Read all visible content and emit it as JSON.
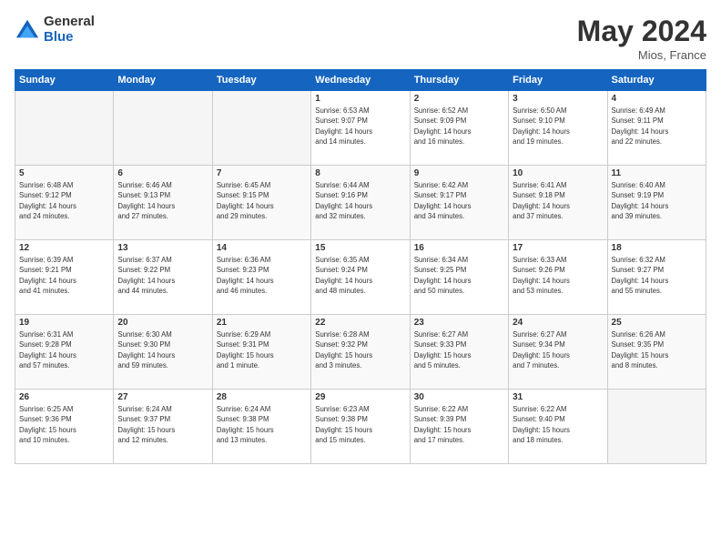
{
  "logo": {
    "general": "General",
    "blue": "Blue"
  },
  "title": {
    "month_year": "May 2024",
    "location": "Mios, France"
  },
  "days_of_week": [
    "Sunday",
    "Monday",
    "Tuesday",
    "Wednesday",
    "Thursday",
    "Friday",
    "Saturday"
  ],
  "weeks": [
    [
      {
        "day": "",
        "info": ""
      },
      {
        "day": "",
        "info": ""
      },
      {
        "day": "",
        "info": ""
      },
      {
        "day": "1",
        "info": "Sunrise: 6:53 AM\nSunset: 9:07 PM\nDaylight: 14 hours\nand 14 minutes."
      },
      {
        "day": "2",
        "info": "Sunrise: 6:52 AM\nSunset: 9:09 PM\nDaylight: 14 hours\nand 16 minutes."
      },
      {
        "day": "3",
        "info": "Sunrise: 6:50 AM\nSunset: 9:10 PM\nDaylight: 14 hours\nand 19 minutes."
      },
      {
        "day": "4",
        "info": "Sunrise: 6:49 AM\nSunset: 9:11 PM\nDaylight: 14 hours\nand 22 minutes."
      }
    ],
    [
      {
        "day": "5",
        "info": "Sunrise: 6:48 AM\nSunset: 9:12 PM\nDaylight: 14 hours\nand 24 minutes."
      },
      {
        "day": "6",
        "info": "Sunrise: 6:46 AM\nSunset: 9:13 PM\nDaylight: 14 hours\nand 27 minutes."
      },
      {
        "day": "7",
        "info": "Sunrise: 6:45 AM\nSunset: 9:15 PM\nDaylight: 14 hours\nand 29 minutes."
      },
      {
        "day": "8",
        "info": "Sunrise: 6:44 AM\nSunset: 9:16 PM\nDaylight: 14 hours\nand 32 minutes."
      },
      {
        "day": "9",
        "info": "Sunrise: 6:42 AM\nSunset: 9:17 PM\nDaylight: 14 hours\nand 34 minutes."
      },
      {
        "day": "10",
        "info": "Sunrise: 6:41 AM\nSunset: 9:18 PM\nDaylight: 14 hours\nand 37 minutes."
      },
      {
        "day": "11",
        "info": "Sunrise: 6:40 AM\nSunset: 9:19 PM\nDaylight: 14 hours\nand 39 minutes."
      }
    ],
    [
      {
        "day": "12",
        "info": "Sunrise: 6:39 AM\nSunset: 9:21 PM\nDaylight: 14 hours\nand 41 minutes."
      },
      {
        "day": "13",
        "info": "Sunrise: 6:37 AM\nSunset: 9:22 PM\nDaylight: 14 hours\nand 44 minutes."
      },
      {
        "day": "14",
        "info": "Sunrise: 6:36 AM\nSunset: 9:23 PM\nDaylight: 14 hours\nand 46 minutes."
      },
      {
        "day": "15",
        "info": "Sunrise: 6:35 AM\nSunset: 9:24 PM\nDaylight: 14 hours\nand 48 minutes."
      },
      {
        "day": "16",
        "info": "Sunrise: 6:34 AM\nSunset: 9:25 PM\nDaylight: 14 hours\nand 50 minutes."
      },
      {
        "day": "17",
        "info": "Sunrise: 6:33 AM\nSunset: 9:26 PM\nDaylight: 14 hours\nand 53 minutes."
      },
      {
        "day": "18",
        "info": "Sunrise: 6:32 AM\nSunset: 9:27 PM\nDaylight: 14 hours\nand 55 minutes."
      }
    ],
    [
      {
        "day": "19",
        "info": "Sunrise: 6:31 AM\nSunset: 9:28 PM\nDaylight: 14 hours\nand 57 minutes."
      },
      {
        "day": "20",
        "info": "Sunrise: 6:30 AM\nSunset: 9:30 PM\nDaylight: 14 hours\nand 59 minutes."
      },
      {
        "day": "21",
        "info": "Sunrise: 6:29 AM\nSunset: 9:31 PM\nDaylight: 15 hours\nand 1 minute."
      },
      {
        "day": "22",
        "info": "Sunrise: 6:28 AM\nSunset: 9:32 PM\nDaylight: 15 hours\nand 3 minutes."
      },
      {
        "day": "23",
        "info": "Sunrise: 6:27 AM\nSunset: 9:33 PM\nDaylight: 15 hours\nand 5 minutes."
      },
      {
        "day": "24",
        "info": "Sunrise: 6:27 AM\nSunset: 9:34 PM\nDaylight: 15 hours\nand 7 minutes."
      },
      {
        "day": "25",
        "info": "Sunrise: 6:26 AM\nSunset: 9:35 PM\nDaylight: 15 hours\nand 8 minutes."
      }
    ],
    [
      {
        "day": "26",
        "info": "Sunrise: 6:25 AM\nSunset: 9:36 PM\nDaylight: 15 hours\nand 10 minutes."
      },
      {
        "day": "27",
        "info": "Sunrise: 6:24 AM\nSunset: 9:37 PM\nDaylight: 15 hours\nand 12 minutes."
      },
      {
        "day": "28",
        "info": "Sunrise: 6:24 AM\nSunset: 9:38 PM\nDaylight: 15 hours\nand 13 minutes."
      },
      {
        "day": "29",
        "info": "Sunrise: 6:23 AM\nSunset: 9:38 PM\nDaylight: 15 hours\nand 15 minutes."
      },
      {
        "day": "30",
        "info": "Sunrise: 6:22 AM\nSunset: 9:39 PM\nDaylight: 15 hours\nand 17 minutes."
      },
      {
        "day": "31",
        "info": "Sunrise: 6:22 AM\nSunset: 9:40 PM\nDaylight: 15 hours\nand 18 minutes."
      },
      {
        "day": "",
        "info": ""
      }
    ]
  ]
}
